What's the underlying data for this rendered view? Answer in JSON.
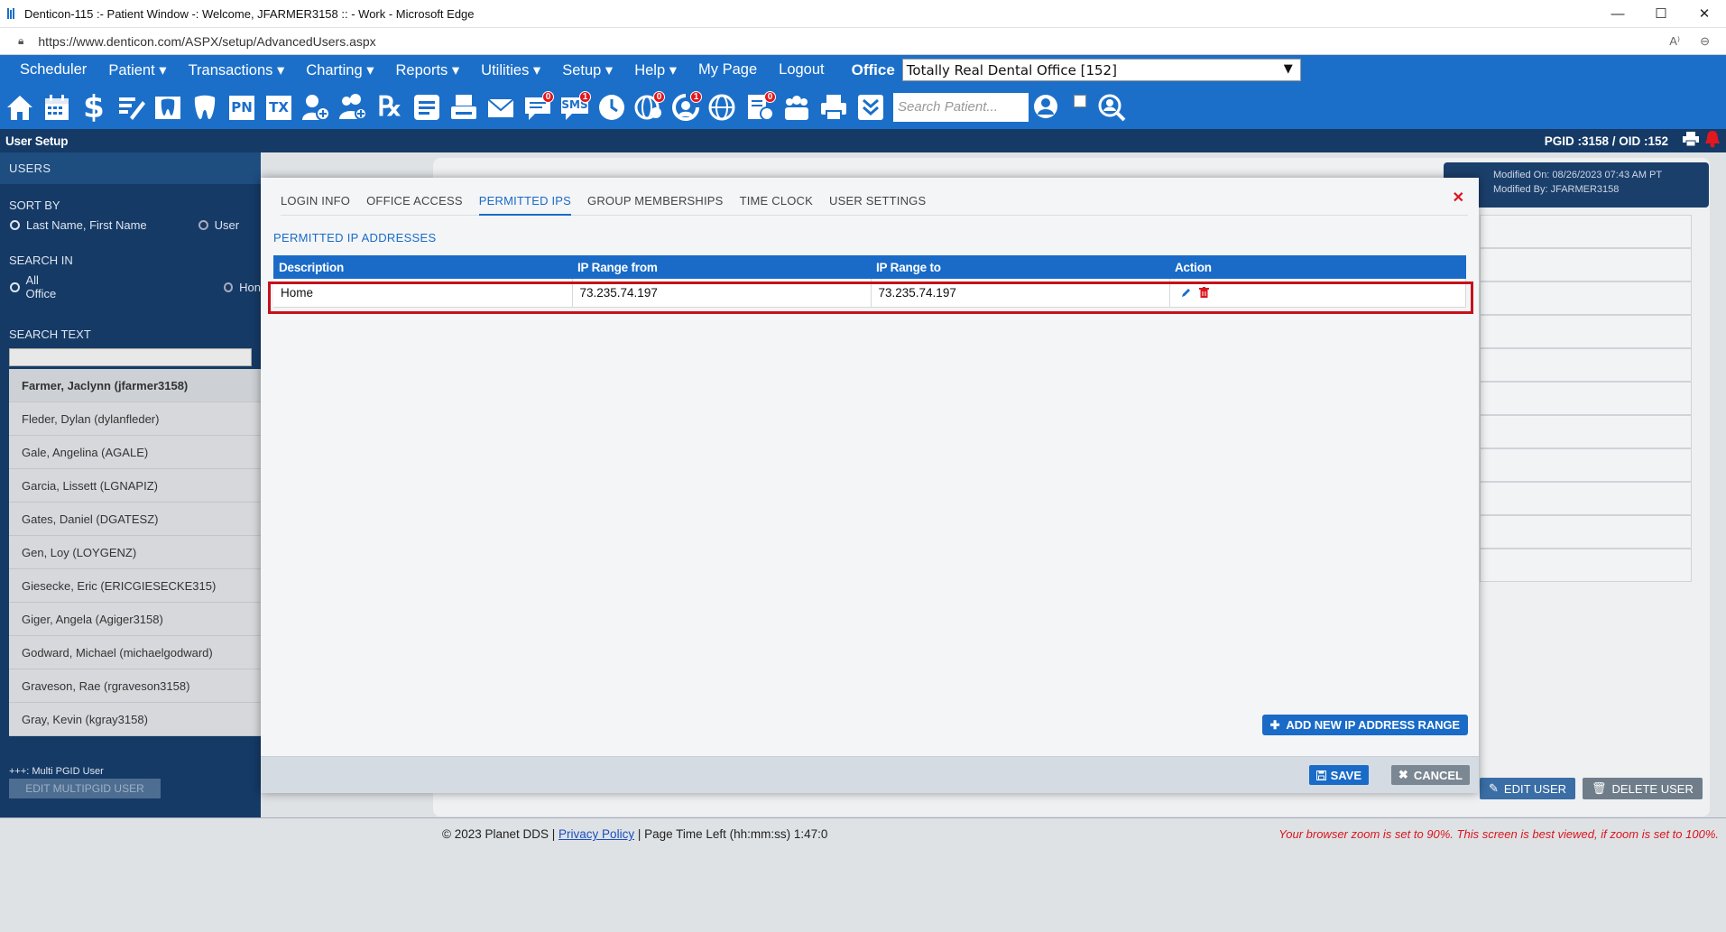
{
  "browser": {
    "window_title": "Denticon-115 :- Patient Window -: Welcome, JFARMER3158 :: - Work - Microsoft Edge",
    "url": "https://www.denticon.com/ASPX/setup/AdvancedUsers.aspx"
  },
  "menu": {
    "items": [
      "Scheduler",
      "Patient ▾",
      "Transactions ▾",
      "Charting ▾",
      "Reports ▾",
      "Utilities ▾",
      "Setup ▾",
      "Help ▾",
      "My Page",
      "Logout"
    ],
    "office_label": "Office",
    "office_value": "Totally Real Dental Office [152]"
  },
  "toolbar": {
    "search_placeholder": "Search Patient...",
    "badges": {
      "notes": "0",
      "sms": "1",
      "globe_user": "0",
      "reload": "1",
      "doc": "0"
    },
    "pn": "PN",
    "tx": "TX",
    "sms": "SMS"
  },
  "header": {
    "title": "User Setup",
    "ids": "PGID :3158  /  OID :152"
  },
  "sidebar": {
    "users_tab": "USERS",
    "sort_by_label": "SORT BY",
    "sort_option1": "Last Name, First Name",
    "sort_option2": "User",
    "search_in_label": "SEARCH IN",
    "search_in_option1": "All Office",
    "search_in_option2": "Hon",
    "search_text_label": "SEARCH TEXT",
    "users": [
      "Farmer, Jaclynn (jfarmer3158)",
      "Fleder, Dylan (dylanfleder)",
      "Gale, Angelina (AGALE)",
      "Garcia, Lissett (LGNAPIZ)",
      "Gates, Daniel (DGATESZ)",
      "Gen, Loy (LOYGENZ)",
      "Giesecke, Eric (ERICGIESECKE315)",
      "Giger, Angela (Agiger3158)",
      "Godward, Michael (michaelgodward)",
      "Graveson, Rae (rgraveson3158)",
      "Gray, Kevin (kgray3158)"
    ],
    "multi_pgid_note": "+++: Multi PGID User",
    "edit_multi_label": "EDIT MULTIPGID USER"
  },
  "background": {
    "modified_on": "Modified On: 08/26/2023 07:43 AM PT",
    "modified_by": "Modified By: JFARMER3158",
    "edit_user": "EDIT USER",
    "delete_user": "DELETE USER"
  },
  "modal": {
    "tabs": [
      "LOGIN INFO",
      "OFFICE ACCESS",
      "PERMITTED IPS",
      "GROUP MEMBERSHIPS",
      "TIME CLOCK",
      "USER SETTINGS"
    ],
    "active_tab": "PERMITTED IPS",
    "section_title": "PERMITTED IP ADDRESSES",
    "table": {
      "headers": [
        "Description",
        "IP Range from",
        "IP Range to",
        "Action"
      ],
      "rows": [
        {
          "description": "Home",
          "from": "73.235.74.197",
          "to": "73.235.74.197"
        }
      ]
    },
    "add_button": "ADD NEW IP ADDRESS RANGE",
    "save_button": "SAVE",
    "cancel_button": "CANCEL"
  },
  "footer": {
    "copyright": "© 2023 Planet DDS |",
    "privacy": "Privacy Policy",
    "page_time": "|  Page Time Left (hh:mm:ss) 1:47:0",
    "zoom_warning": "Your browser zoom is set to 90%. This screen is best viewed, if zoom is set to 100%."
  },
  "colors": {
    "primary": "#1b6fc9",
    "dark_nav": "#153a66",
    "highlight": "#c5121b"
  }
}
